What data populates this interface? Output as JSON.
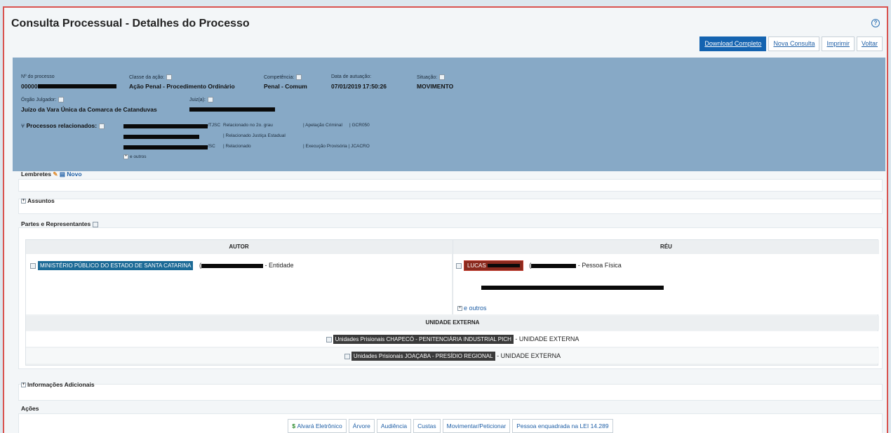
{
  "page": {
    "title": "Consulta Processual - Detalhes do Processo",
    "help_icon": "question-circle-icon"
  },
  "toolbar": {
    "download": "Download Completo",
    "nova_consulta": "Nova Consulta",
    "imprimir": "Imprimir",
    "voltar": "Voltar",
    "accent": "#1463b0"
  },
  "header": {
    "bg_color": "#87a9c6",
    "processo_label": "Nº do processo",
    "processo_value_prefix": "00000",
    "classe_label": "Classe da ação:",
    "classe_value": "Ação Penal - Procedimento Ordinário",
    "competencia_label": "Competência:",
    "competencia_value": "Penal - Comum",
    "data_label": "Data de autuação:",
    "data_value": "07/01/2019 17:50:26",
    "situacao_label": "Situação:",
    "situacao_value": "MOVIMENTO",
    "orgao_label": "Órgão Julgador:",
    "orgao_value": "Juízo da Vara Única da Comarca de Catanduvas",
    "juiz_label": "Juiz(a):",
    "relacionados_label": "Processos relacionados:",
    "relacionados": [
      {
        "suffix": "/TJSC",
        "relacao": "Relacionado no 2o. grau",
        "classe": "Apelação Criminal",
        "codigo": "GCR050"
      },
      {
        "suffix": "",
        "relacao": "Relacionado Justiça Estadual",
        "classe": "",
        "codigo": ""
      },
      {
        "suffix": "/SC",
        "relacao": "Relacionado",
        "classe": "Execução Provisória",
        "codigo": "JCACRO"
      }
    ],
    "e_outros": "e outros"
  },
  "lembretes": {
    "title": "Lembretes",
    "novo": "Novo"
  },
  "assuntos": {
    "title": "Assuntos"
  },
  "partes": {
    "title": "Partes e Representantes",
    "autor_header": "AUTOR",
    "reu_header": "RÉU",
    "autor_name": "MINISTÉRIO PÚBLICO DO ESTADO DE SANTA CATARINA",
    "autor_tipo": "- Entidade",
    "reu_name": "LUCAS",
    "reu_tipo": "- Pessoa Física",
    "e_outros": "e outros",
    "unidade_header": "UNIDADE EXTERNA",
    "unidades": [
      {
        "name": "Unidades Prisionais CHAPECÓ - PENITENCIÁRIA INDUSTRIAL PICH",
        "tipo": "- UNIDADE EXTERNA"
      },
      {
        "name": "Unidades Prisionais JOAÇABA - PRESÍDIO REGIONAL",
        "tipo": "- UNIDADE EXTERNA"
      }
    ]
  },
  "info_adicionais": {
    "title": "Informações Adicionais"
  },
  "acoes": {
    "title": "Ações",
    "buttons": [
      "Alvará Eletrônico",
      "Árvore",
      "Audiência",
      "Custas",
      "Movimentar/Peticionar",
      "Pessoa enquadrada na LEI 14.289"
    ]
  }
}
